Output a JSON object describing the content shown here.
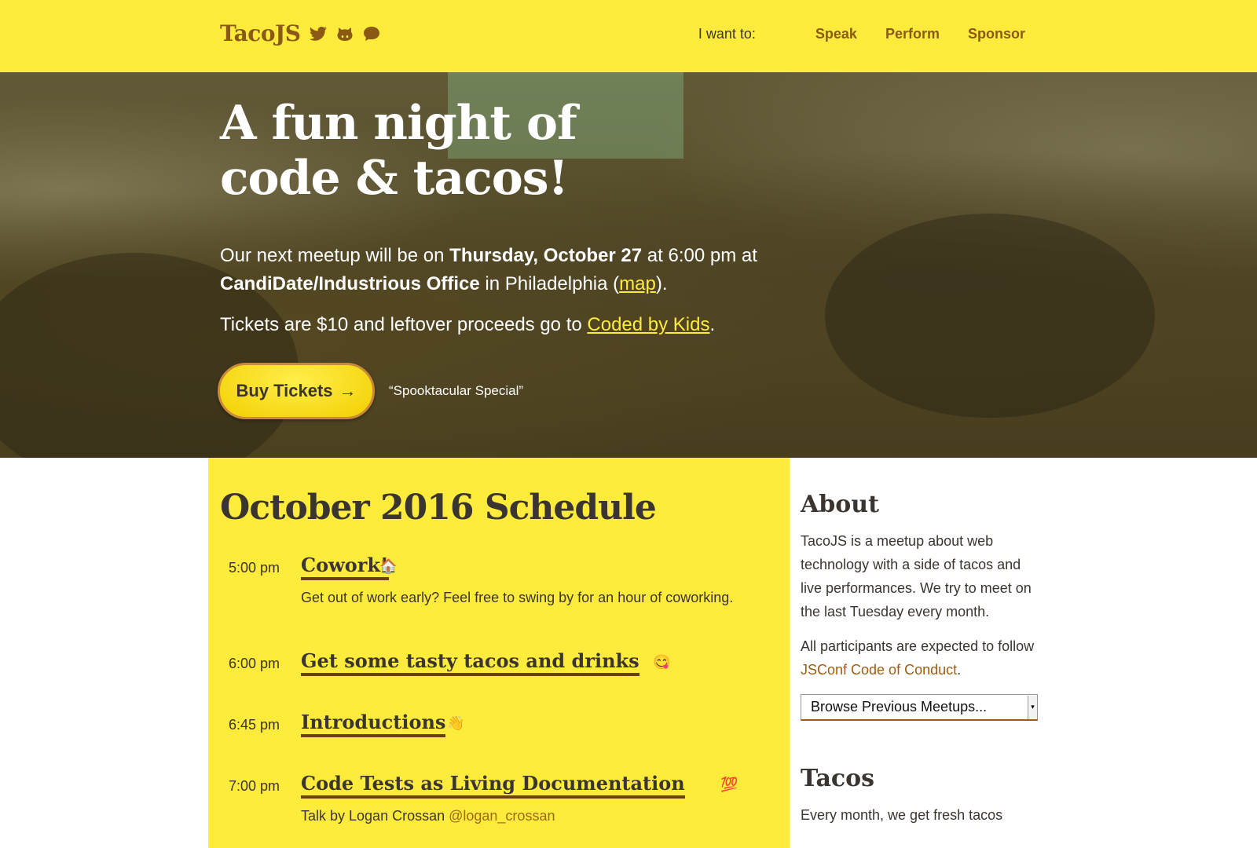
{
  "header": {
    "brand": "TacoJS",
    "icons": [
      "twitter-icon",
      "github-icon",
      "chat-icon"
    ],
    "nav_prompt": "I want to:",
    "nav": [
      "Speak",
      "Perform",
      "Sponsor"
    ]
  },
  "hero": {
    "title_line1": "A fun night of",
    "title_line2": "code & tacos!",
    "p1_pre": "Our next meetup will be on ",
    "p1_date": "Thursday, October 27",
    "p1_mid": " at 6:00 pm at",
    "p1_venue": "CandiDate/Industrious Office",
    "p1_post": " in Philadelphia (",
    "p1_map": "map",
    "p1_end": ").",
    "p2_pre": "Tickets are $10 and leftover proceeds go to ",
    "p2_link": "Coded by Kids",
    "p2_end": ".",
    "buy_label": "Buy Tickets",
    "buy_arrow": "→",
    "special": "“Spooktacular Special”"
  },
  "schedule": {
    "title": "October 2016 Schedule",
    "items": [
      {
        "time": "5:00 pm",
        "title": "Cowork!",
        "emoji": "🏠",
        "desc": "Get out of work early? Feel free to swing by for an hour of coworking."
      },
      {
        "time": "6:00 pm",
        "title": "Get some tasty tacos and drinks",
        "emoji": "😋"
      },
      {
        "time": "6:45 pm",
        "title": "Introductions",
        "emoji": "👋"
      },
      {
        "time": "7:00 pm",
        "title": "Code Tests as Living Documentation",
        "emoji": "💯",
        "desc_pre": "Talk by Logan Crossan ",
        "handle": "@logan_crossan"
      }
    ]
  },
  "sidebar": {
    "about_title": "About",
    "about_text": "TacoJS is a meetup about web technology with a side of tacos and live performances. We try to meet on the last Tuesday every month.",
    "conduct_pre": "All participants are expected to follow ",
    "conduct_link": "JSConf Code of Conduct",
    "conduct_end": ".",
    "select_value": "Browse Previous Meetups...",
    "tacos_title": "Tacos",
    "tacos_text": "Every month, we get fresh tacos"
  },
  "colors": {
    "accent": "#ffeb3b",
    "brand": "#8a5a14",
    "link": "#a05d10"
  }
}
